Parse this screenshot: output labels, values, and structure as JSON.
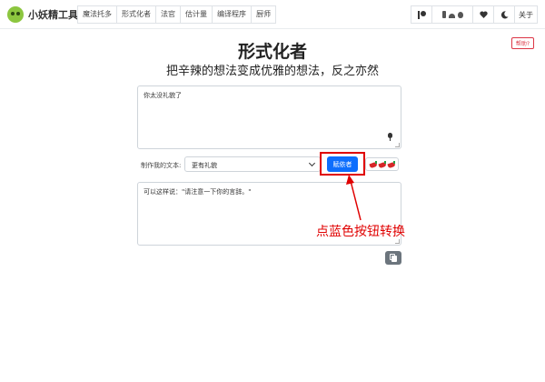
{
  "brand": {
    "name": "小妖精工具",
    "logo_icon": "goblin-logo"
  },
  "nav": {
    "links": [
      "魔法托多",
      "形式化者",
      "法官",
      "估计量",
      "编译程序",
      "厨师"
    ],
    "right": {
      "patreon_icon": "patreon-icon",
      "device_icons": [
        "phone-icon",
        "android-icon",
        "apple-icon"
      ],
      "heart_icon": "heart-icon",
      "moon_icon": "moon-icon",
      "about_label": "关于"
    }
  },
  "help_label": "帮助?",
  "page": {
    "title": "形式化者",
    "subtitle": "把辛辣的想法变成优雅的想法，反之亦然"
  },
  "input": {
    "value": "你太没礼貌了"
  },
  "options": {
    "label": "制作我的文本:",
    "selected": "更有礼貌",
    "submit_label": "赋依者",
    "spice_level": 3
  },
  "output": {
    "value": "可以这样说：\"请注意一下你的言辞。\""
  },
  "annotation": {
    "text": "点蓝色按钮转换"
  },
  "colors": {
    "primary": "#0d6efd",
    "annotation": "#e00000",
    "chili": "#d62828",
    "help": "#dc3545"
  }
}
